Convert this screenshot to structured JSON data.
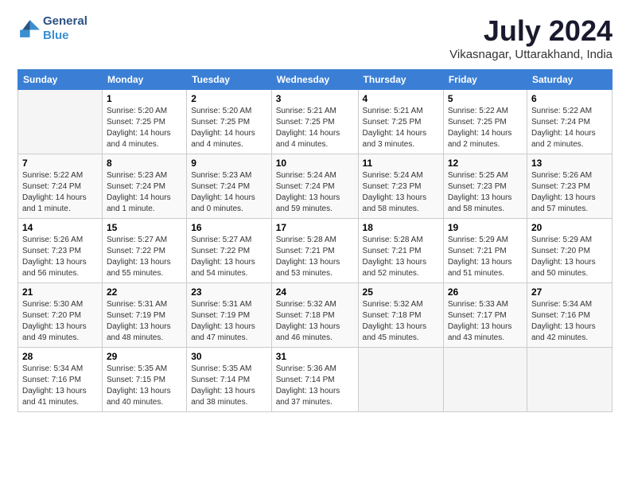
{
  "logo": {
    "line1": "General",
    "line2": "Blue"
  },
  "title": "July 2024",
  "location": "Vikasnagar, Uttarakhand, India",
  "headers": [
    "Sunday",
    "Monday",
    "Tuesday",
    "Wednesday",
    "Thursday",
    "Friday",
    "Saturday"
  ],
  "weeks": [
    [
      {
        "day": "",
        "info": ""
      },
      {
        "day": "1",
        "info": "Sunrise: 5:20 AM\nSunset: 7:25 PM\nDaylight: 14 hours\nand 4 minutes."
      },
      {
        "day": "2",
        "info": "Sunrise: 5:20 AM\nSunset: 7:25 PM\nDaylight: 14 hours\nand 4 minutes."
      },
      {
        "day": "3",
        "info": "Sunrise: 5:21 AM\nSunset: 7:25 PM\nDaylight: 14 hours\nand 4 minutes."
      },
      {
        "day": "4",
        "info": "Sunrise: 5:21 AM\nSunset: 7:25 PM\nDaylight: 14 hours\nand 3 minutes."
      },
      {
        "day": "5",
        "info": "Sunrise: 5:22 AM\nSunset: 7:25 PM\nDaylight: 14 hours\nand 2 minutes."
      },
      {
        "day": "6",
        "info": "Sunrise: 5:22 AM\nSunset: 7:24 PM\nDaylight: 14 hours\nand 2 minutes."
      }
    ],
    [
      {
        "day": "7",
        "info": "Sunrise: 5:22 AM\nSunset: 7:24 PM\nDaylight: 14 hours\nand 1 minute."
      },
      {
        "day": "8",
        "info": "Sunrise: 5:23 AM\nSunset: 7:24 PM\nDaylight: 14 hours\nand 1 minute."
      },
      {
        "day": "9",
        "info": "Sunrise: 5:23 AM\nSunset: 7:24 PM\nDaylight: 14 hours\nand 0 minutes."
      },
      {
        "day": "10",
        "info": "Sunrise: 5:24 AM\nSunset: 7:24 PM\nDaylight: 13 hours\nand 59 minutes."
      },
      {
        "day": "11",
        "info": "Sunrise: 5:24 AM\nSunset: 7:23 PM\nDaylight: 13 hours\nand 58 minutes."
      },
      {
        "day": "12",
        "info": "Sunrise: 5:25 AM\nSunset: 7:23 PM\nDaylight: 13 hours\nand 58 minutes."
      },
      {
        "day": "13",
        "info": "Sunrise: 5:26 AM\nSunset: 7:23 PM\nDaylight: 13 hours\nand 57 minutes."
      }
    ],
    [
      {
        "day": "14",
        "info": "Sunrise: 5:26 AM\nSunset: 7:23 PM\nDaylight: 13 hours\nand 56 minutes."
      },
      {
        "day": "15",
        "info": "Sunrise: 5:27 AM\nSunset: 7:22 PM\nDaylight: 13 hours\nand 55 minutes."
      },
      {
        "day": "16",
        "info": "Sunrise: 5:27 AM\nSunset: 7:22 PM\nDaylight: 13 hours\nand 54 minutes."
      },
      {
        "day": "17",
        "info": "Sunrise: 5:28 AM\nSunset: 7:21 PM\nDaylight: 13 hours\nand 53 minutes."
      },
      {
        "day": "18",
        "info": "Sunrise: 5:28 AM\nSunset: 7:21 PM\nDaylight: 13 hours\nand 52 minutes."
      },
      {
        "day": "19",
        "info": "Sunrise: 5:29 AM\nSunset: 7:21 PM\nDaylight: 13 hours\nand 51 minutes."
      },
      {
        "day": "20",
        "info": "Sunrise: 5:29 AM\nSunset: 7:20 PM\nDaylight: 13 hours\nand 50 minutes."
      }
    ],
    [
      {
        "day": "21",
        "info": "Sunrise: 5:30 AM\nSunset: 7:20 PM\nDaylight: 13 hours\nand 49 minutes."
      },
      {
        "day": "22",
        "info": "Sunrise: 5:31 AM\nSunset: 7:19 PM\nDaylight: 13 hours\nand 48 minutes."
      },
      {
        "day": "23",
        "info": "Sunrise: 5:31 AM\nSunset: 7:19 PM\nDaylight: 13 hours\nand 47 minutes."
      },
      {
        "day": "24",
        "info": "Sunrise: 5:32 AM\nSunset: 7:18 PM\nDaylight: 13 hours\nand 46 minutes."
      },
      {
        "day": "25",
        "info": "Sunrise: 5:32 AM\nSunset: 7:18 PM\nDaylight: 13 hours\nand 45 minutes."
      },
      {
        "day": "26",
        "info": "Sunrise: 5:33 AM\nSunset: 7:17 PM\nDaylight: 13 hours\nand 43 minutes."
      },
      {
        "day": "27",
        "info": "Sunrise: 5:34 AM\nSunset: 7:16 PM\nDaylight: 13 hours\nand 42 minutes."
      }
    ],
    [
      {
        "day": "28",
        "info": "Sunrise: 5:34 AM\nSunset: 7:16 PM\nDaylight: 13 hours\nand 41 minutes."
      },
      {
        "day": "29",
        "info": "Sunrise: 5:35 AM\nSunset: 7:15 PM\nDaylight: 13 hours\nand 40 minutes."
      },
      {
        "day": "30",
        "info": "Sunrise: 5:35 AM\nSunset: 7:14 PM\nDaylight: 13 hours\nand 38 minutes."
      },
      {
        "day": "31",
        "info": "Sunrise: 5:36 AM\nSunset: 7:14 PM\nDaylight: 13 hours\nand 37 minutes."
      },
      {
        "day": "",
        "info": ""
      },
      {
        "day": "",
        "info": ""
      },
      {
        "day": "",
        "info": ""
      }
    ]
  ]
}
